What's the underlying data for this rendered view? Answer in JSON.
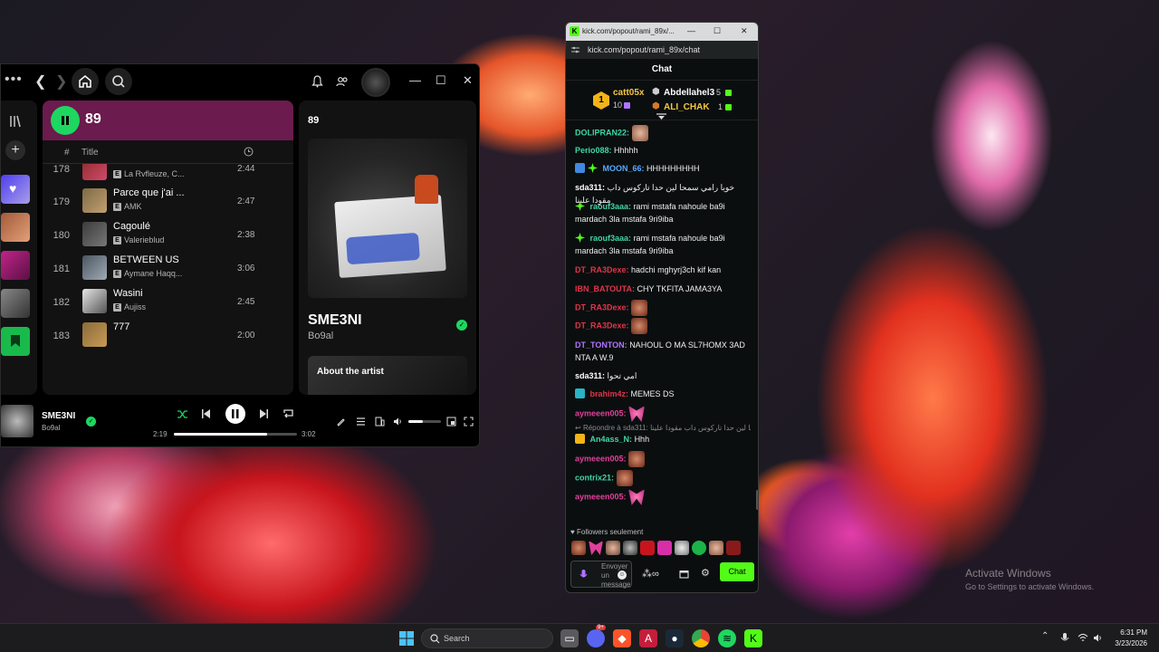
{
  "spotify": {
    "playlist_title": "89",
    "col_number": "#",
    "col_title": "Title",
    "tracks": [
      {
        "num": "178",
        "title": "",
        "artist": "La Rvfleuze, C...",
        "duration": "2:44",
        "explicit": true,
        "color": "#7a2a2a"
      },
      {
        "num": "179",
        "title": "Parce que j'ai ...",
        "artist": "AMK",
        "duration": "2:47",
        "explicit": true,
        "color": "#7d6a45"
      },
      {
        "num": "180",
        "title": "Cagoulé",
        "artist": "Valerieblud",
        "duration": "2:38",
        "explicit": true,
        "color": "#3c3c3c"
      },
      {
        "num": "181",
        "title": "BETWEEN US",
        "artist": "Aymane Haqq...",
        "duration": "3:06",
        "explicit": true,
        "color": "#4b5662"
      },
      {
        "num": "182",
        "title": "Wasini",
        "artist": "Aujiss",
        "duration": "2:45",
        "explicit": true,
        "color": "#d8d8d8"
      },
      {
        "num": "183",
        "title": "777",
        "artist": "",
        "duration": "2:00",
        "explicit": false,
        "color": "#8a6b3a"
      }
    ],
    "now_playing_panel": {
      "header": "89",
      "song": "SME3NI",
      "artist": "Bo9al",
      "about": "About the artist"
    },
    "player": {
      "song": "SME3NI",
      "artist": "Bo9al",
      "elapsed": "2:19",
      "total": "3:02",
      "progress": 0.76,
      "volume": 0.45
    }
  },
  "kick": {
    "window_title": "kick.com/popout/rami_89x/...",
    "url": "kick.com/popout/rami_89x/chat",
    "chat_header": "Chat",
    "pinned": [
      {
        "user": "catt05x",
        "count": "10"
      },
      {
        "user": "Abdellahel3",
        "count": "5"
      },
      {
        "user": "ALI_CHAK",
        "count": "1"
      }
    ],
    "messages": [
      {
        "user": "DOLIPRAN22:",
        "text": "",
        "color": "#3fd6a4",
        "emote": true
      },
      {
        "user": "Perio088:",
        "text": "Hhhhh",
        "color": "#3fd6a4"
      },
      {
        "user": "MOON_66:",
        "text": "HHHHHHHHH",
        "color": "#5aa9ff"
      },
      {
        "user": "sda311:",
        "text": "خويا رامي سمحا لين حدا تاركوس داب مقودا علينا",
        "color": "#ffffff"
      },
      {
        "user": "raouf3aaa:",
        "text": "rami mstafa nahoule ba9i mardach 3la mstafa 9ri9iba",
        "color": "#3fd6a4"
      },
      {
        "user": "raouf3aaa:",
        "text": "rami mstafa nahoule ba9i mardach 3la mstafa 9ri9iba",
        "color": "#3fd6a4"
      },
      {
        "user": "DT_RA3Dexe:",
        "text": "hadchi mghyrj3ch kif kan",
        "color": "#e0344a"
      },
      {
        "user": "IBN_BATOUTA:",
        "text": "CHY TKFITA JAMA3YA",
        "color": "#e0344a"
      },
      {
        "user": "DT_RA3Dexe:",
        "text": "",
        "color": "#e0344a",
        "emote": true
      },
      {
        "user": "DT_RA3Dexe:",
        "text": "",
        "color": "#e0344a",
        "emote": true
      },
      {
        "user": "DT_TONTON:",
        "text": "NAHOUL O MA SL7HOMX 3AD NTA A W.9",
        "color": "#b074ff"
      },
      {
        "user": "sda311:",
        "text": "امي تحوا",
        "color": "#ffffff"
      },
      {
        "user": "brahim4z:",
        "text": "MEMES DS",
        "color": "#e0344a"
      },
      {
        "user": "aymeeen005:",
        "text": "",
        "color": "#e0409b",
        "emote": true
      },
      {
        "user": "An4ass_N:",
        "text": "Hhh",
        "color": "#3fd6a4"
      },
      {
        "user": "aymeeen005:",
        "text": "",
        "color": "#e0409b",
        "emote": true
      },
      {
        "user": "contrix21:",
        "text": "",
        "color": "#3fd6a4",
        "emote": true
      },
      {
        "user": "aymeeen005:",
        "text": "",
        "color": "#e0409b",
        "emote": true
      }
    ],
    "reply_line": "Répondre à sda311: خويا رامي سمحا لين حدا تاركوس داب مقودا علينا",
    "followers_only": "Followers seulement",
    "input_placeholder": "Envoyer un message",
    "send_label": "Chat"
  },
  "taskbar": {
    "search_placeholder": "Search",
    "time": "6:31 PM",
    "date": "3/23/2026",
    "discord_badge": "9+"
  },
  "watermark": {
    "title": "Activate Windows",
    "subtitle": "Go to Settings to activate Windows."
  }
}
